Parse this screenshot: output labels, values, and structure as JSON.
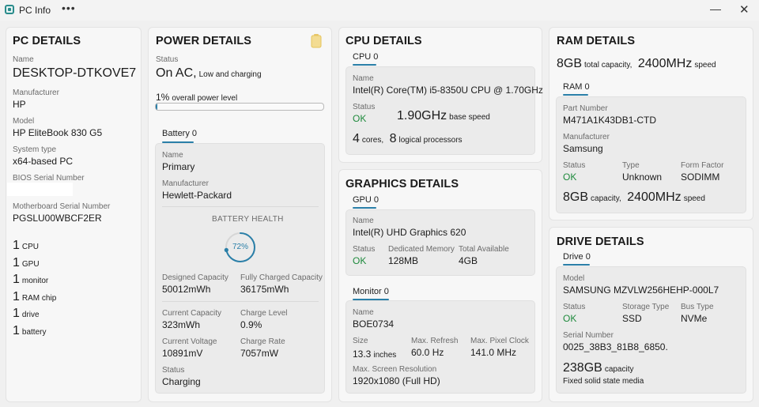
{
  "app": {
    "title": "PC Info",
    "menu_dots": "•••",
    "minimize": "—",
    "close": "✕",
    "accent": "#2a7fa8",
    "ok_color": "#1e8a3c"
  },
  "pc": {
    "heading": "PC DETAILS",
    "name_label": "Name",
    "name": "DESKTOP-DTKOVE7",
    "manufacturer_label": "Manufacturer",
    "manufacturer": "HP",
    "model_label": "Model",
    "model": "HP EliteBook 830 G5",
    "system_type_label": "System type",
    "system_type": "x64-based PC",
    "bios_label": "BIOS Serial Number",
    "mb_label": "Motherboard Serial Number",
    "mb_serial": "PGSLU00WBCF2ER",
    "counts": [
      {
        "n": "1",
        "u": "CPU"
      },
      {
        "n": "1",
        "u": "GPU"
      },
      {
        "n": "1",
        "u": "monitor"
      },
      {
        "n": "1",
        "u": "RAM chip"
      },
      {
        "n": "1",
        "u": "drive"
      },
      {
        "n": "1",
        "u": "battery"
      }
    ]
  },
  "power": {
    "heading": "POWER DETAILS",
    "status_label": "Status",
    "status": "On AC,",
    "status_note": "Low and charging",
    "level": "1%",
    "level_note": "overall power level",
    "level_fraction": 0.01,
    "battery_tab": "Battery 0",
    "name_label": "Name",
    "name": "Primary",
    "manufacturer_label": "Manufacturer",
    "manufacturer": "Hewlett-Packard",
    "health_label": "BATTERY HEALTH",
    "health": "72%",
    "health_fraction": 0.72,
    "designed_label": "Designed Capacity",
    "designed": "50012mWh",
    "full_label": "Fully Charged Capacity",
    "full": "36175mWh",
    "current_cap_label": "Current Capacity",
    "current_cap": "323mWh",
    "charge_level_label": "Charge Level",
    "charge_level": "0.9%",
    "voltage_label": "Current Voltage",
    "voltage": "10891mV",
    "rate_label": "Charge Rate",
    "rate": "7057mW",
    "status2_label": "Status",
    "status2": "Charging"
  },
  "cpu": {
    "heading": "CPU DETAILS",
    "tab": "CPU 0",
    "name_label": "Name",
    "name": "Intel(R) Core(TM) i5-8350U CPU @ 1.70GHz",
    "status_label": "Status",
    "status": "OK",
    "speed": "1.90GHz",
    "speed_note": "base speed",
    "cores": "4",
    "cores_unit": "cores,",
    "logical": "8",
    "logical_unit": "logical processors"
  },
  "gpu": {
    "heading": "GRAPHICS DETAILS",
    "tab": "GPU 0",
    "name_label": "Name",
    "name": "Intel(R) UHD Graphics 620",
    "status_label": "Status",
    "status": "OK",
    "mem_label": "Dedicated Memory",
    "mem": "128MB",
    "total_label": "Total Available",
    "total": "4GB",
    "monitor_tab": "Monitor 0",
    "mon_name_label": "Name",
    "mon_name": "BOE0734",
    "size_label": "Size",
    "size": "13.3",
    "size_unit": "inches",
    "refresh_label": "Max. Refresh",
    "refresh": "60.0 Hz",
    "clock_label": "Max. Pixel Clock",
    "clock": "141.0 MHz",
    "res_label": "Max. Screen Resolution",
    "res": "1920x1080 (Full HD)"
  },
  "ram": {
    "heading": "RAM DETAILS",
    "total": "8GB",
    "total_note": "total capacity,",
    "speed": "2400MHz",
    "speed_note": "speed",
    "tab": "RAM 0",
    "part_label": "Part Number",
    "part": "M471A1K43DB1-CTD",
    "manufacturer_label": "Manufacturer",
    "manufacturer": "Samsung",
    "status_label": "Status",
    "status": "OK",
    "type_label": "Type",
    "type": "Unknown",
    "form_label": "Form Factor",
    "form": "SODIMM",
    "cap": "8GB",
    "cap_note": "capacity,",
    "cap_speed": "2400MHz",
    "cap_speed_note": "speed"
  },
  "drive": {
    "heading": "DRIVE DETAILS",
    "tab": "Drive 0",
    "model_label": "Model",
    "model": "SAMSUNG MZVLW256HEHP-000L7",
    "status_label": "Status",
    "status": "OK",
    "storage_label": "Storage Type",
    "storage": "SSD",
    "bus_label": "Bus Type",
    "bus": "NVMe",
    "serial_label": "Serial Number",
    "serial": "0025_38B3_81B8_6850.",
    "cap": "238GB",
    "cap_note": "capacity",
    "media": "Fixed solid state media"
  }
}
